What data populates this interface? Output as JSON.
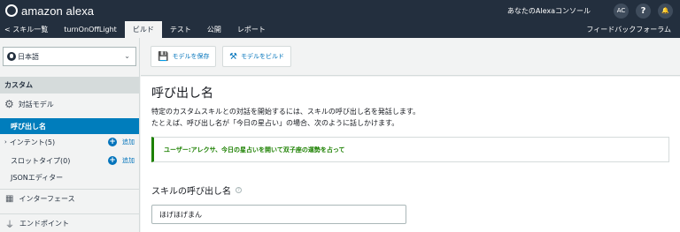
{
  "header": {
    "logo_text": "amazon alexa",
    "console_label": "あなたのAlexaコンソール",
    "avatar_initials": "AC",
    "help_label": "?",
    "notifications_label": "🔔"
  },
  "nav": {
    "back_label": "< スキル一覧",
    "skill_name": "turnOnOffLight",
    "tabs": [
      {
        "label": "ビルド",
        "active": true
      },
      {
        "label": "テスト",
        "active": false
      },
      {
        "label": "公開",
        "active": false
      },
      {
        "label": "レポート",
        "active": false
      }
    ],
    "feedback_label": "フィードバックフォーラム"
  },
  "sidebar": {
    "language": "日本語",
    "section_title": "カスタム",
    "items": [
      {
        "label": "対話モデル"
      },
      {
        "label": "呼び出し名",
        "active": true
      },
      {
        "label": "インテント(5)",
        "add_label": "追加"
      },
      {
        "label": "スロットタイプ(0)",
        "add_label": "追加"
      },
      {
        "label": "JSONエディター"
      },
      {
        "label": "インターフェース"
      },
      {
        "label": "エンドポイント"
      }
    ]
  },
  "toolbar": {
    "save_label": "モデルを保存",
    "build_label": "モデルをビルド"
  },
  "main": {
    "title": "呼び出し名",
    "desc_line1": "特定のカスタムスキルとの対話を開始するには、スキルの呼び出し名を発話します。",
    "desc_line2": "たとえば、呼び出し名が「今日の星占い」の場合、次のように話しかけます。",
    "example": "ユーザー:アレクサ、今日の星占いを開いて双子座の運勢を占って",
    "field_label": "スキルの呼び出し名",
    "field_value": "ほげほげまん"
  },
  "colors": {
    "topbar": "#232f3e",
    "accent_blue": "#0073bb",
    "active_item": "#007dbc",
    "example_green": "#1d8102"
  }
}
